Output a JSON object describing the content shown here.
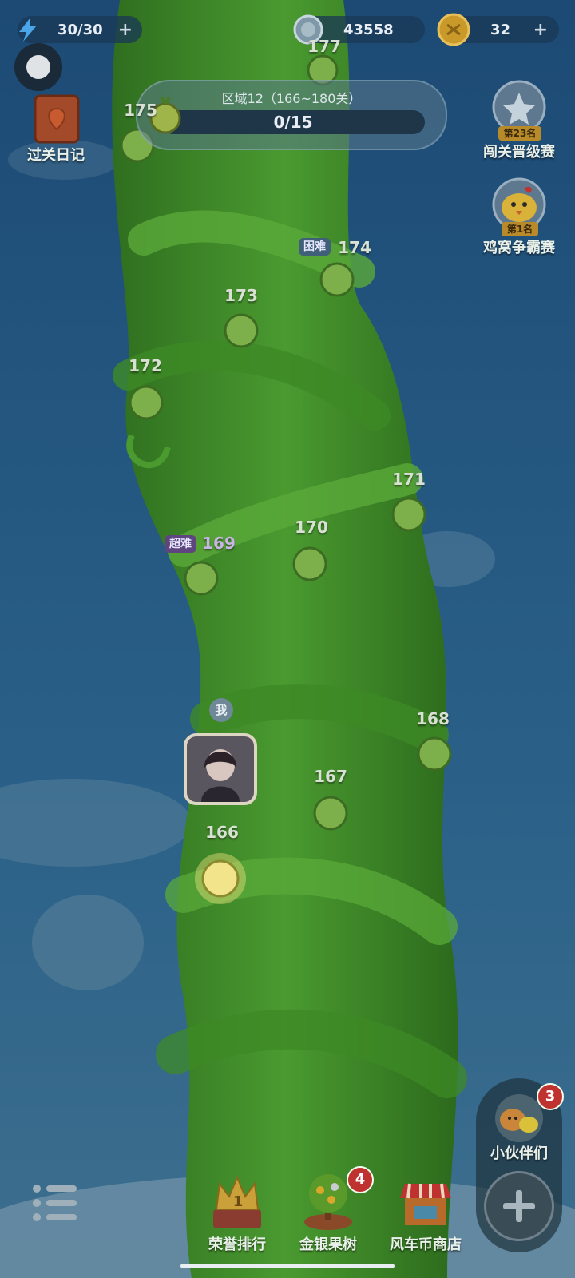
{
  "top": {
    "energy": "30/30",
    "gems": "43558",
    "coins": "32",
    "plus": "+"
  },
  "zone": {
    "title": "区域12（166~180关）",
    "progress_text": "0/15",
    "progress": 0
  },
  "left_buttons": {
    "diary": "过关日记"
  },
  "right_buttons": {
    "promotion": "闯关晋级赛",
    "promotion_rank": "第23名",
    "nest": "鸡窝争霸赛",
    "nest_rank": "第1名"
  },
  "levels": {
    "l177": "177",
    "l175": "175",
    "l174": "174",
    "l173": "173",
    "l172": "172",
    "l171": "171",
    "l170": "170",
    "l169": "169",
    "l168": "168",
    "l167": "167",
    "l166": "166"
  },
  "tags": {
    "hard": "困难",
    "super_hard": "超难"
  },
  "me_label": "我",
  "partners": {
    "label": "小伙伴们",
    "badge": "3"
  },
  "bottom": {
    "honor": "荣誉排行",
    "honor_rank": "1",
    "tree": "金银果树",
    "tree_badge": "4",
    "shop": "风车币商店"
  },
  "colors": {
    "sky": "#1f4f7a",
    "vine": "#3f8a2a",
    "accent": "#c0322f"
  }
}
